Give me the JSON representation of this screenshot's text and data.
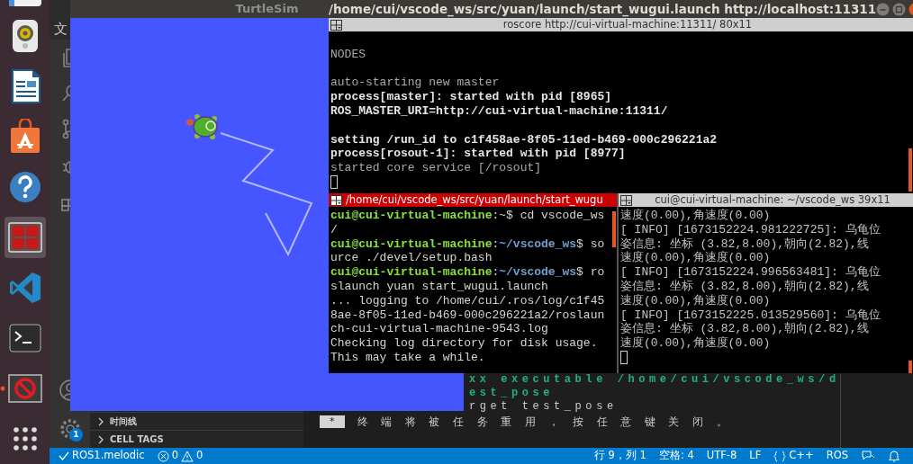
{
  "dock": {
    "items": [
      {
        "kind": "files",
        "selected": false,
        "running": false
      },
      {
        "kind": "speaker",
        "selected": false,
        "running": false
      },
      {
        "kind": "writer",
        "selected": false,
        "running": false
      },
      {
        "kind": "store",
        "selected": false,
        "running": false
      },
      {
        "kind": "help",
        "selected": false,
        "running": false
      },
      {
        "kind": "terminator",
        "selected": true,
        "running": false
      },
      {
        "kind": "vscode",
        "selected": false,
        "running": false
      },
      {
        "kind": "terminal",
        "selected": false,
        "running": false
      },
      {
        "kind": "blocked",
        "selected": false,
        "running": true
      },
      {
        "kind": "apps",
        "selected": false,
        "running": false
      }
    ]
  },
  "vscode": {
    "menu_fragment": "文",
    "settings_badge": "1",
    "sidebar_sections": [
      {
        "label": "时间线",
        "expanded": false
      },
      {
        "label": "CELL TAGS",
        "expanded": false
      }
    ],
    "terminal_lines": [
      {
        "kind": "cut_build",
        "text": "xx executable /home/cui/vscode_ws/d"
      },
      {
        "kind": "cut_build",
        "text": "est_pose"
      },
      {
        "kind": "cut_plain",
        "text": "rget test_pose"
      },
      {
        "kind": "notice",
        "badge": "*",
        "text": "终 端 将 被 任 务 重 用 ， 按 任 意 键 关 闭 。"
      }
    ],
    "status_bar": {
      "left": [
        {
          "kind": "sync",
          "text": "ROS1.melodic"
        },
        {
          "kind": "problems",
          "errors": "0",
          "warnings": "0"
        }
      ],
      "right": [
        {
          "kind": "text",
          "text": "行 9，列 1"
        },
        {
          "kind": "text",
          "text": "空格: 4"
        },
        {
          "kind": "text",
          "text": "UTF-8"
        },
        {
          "kind": "text",
          "text": "LF"
        },
        {
          "kind": "language",
          "text": "C++"
        },
        {
          "kind": "text",
          "text": "ROS"
        },
        {
          "kind": "feedback"
        },
        {
          "kind": "bell"
        }
      ]
    }
  },
  "turtlesim": {
    "title": "TurtleSim"
  },
  "terminator": {
    "title": "/home/cui/vscode_ws/src/yuan/launch/start_wugui.launch http://localhost:11311",
    "panes": [
      {
        "header": "roscore http://cui-virtual-machine:11311/ 80x11",
        "active": false,
        "cursor": true,
        "lines": [
          {
            "kind": "blank"
          },
          {
            "kind": "text",
            "segments": [
              {
                "kind": "plain",
                "text": "NODES"
              }
            ]
          },
          {
            "kind": "blank"
          },
          {
            "kind": "text",
            "segments": [
              {
                "kind": "plain",
                "text": "auto-starting new master"
              }
            ]
          },
          {
            "kind": "text",
            "segments": [
              {
                "kind": "bold",
                "text": "process[master]: started with pid [8965]"
              }
            ]
          },
          {
            "kind": "text",
            "segments": [
              {
                "kind": "bold",
                "text": "ROS_MASTER_URI=http://cui-virtual-machine:11311/"
              }
            ]
          },
          {
            "kind": "blank"
          },
          {
            "kind": "text",
            "segments": [
              {
                "kind": "bold",
                "text": "setting /run_id to c1f458ae-8f05-11ed-b469-000c296221a2"
              }
            ]
          },
          {
            "kind": "text",
            "segments": [
              {
                "kind": "bold",
                "text": "process[rosout-1]: started with pid [8977]"
              }
            ]
          },
          {
            "kind": "text",
            "segments": [
              {
                "kind": "plain",
                "text": "started core service [/rosout]"
              }
            ]
          }
        ]
      },
      {
        "header": "/home/cui/vscode_ws/src/yuan/launch/start_wugu",
        "active": true,
        "cursor": false,
        "lines": [
          {
            "kind": "text",
            "segments": [
              {
                "kind": "user",
                "text": "cui@cui-virtual-machine"
              },
              {
                "kind": "plain",
                "text": ":~$ cd vscode_ws"
              }
            ]
          },
          {
            "kind": "text",
            "segments": [
              {
                "kind": "plain",
                "text": "/"
              }
            ]
          },
          {
            "kind": "text",
            "segments": [
              {
                "kind": "user",
                "text": "cui@cui-virtual-machine"
              },
              {
                "kind": "plain",
                "text": ":"
              },
              {
                "kind": "path",
                "text": "~/vscode_ws"
              },
              {
                "kind": "plain",
                "text": "$ so"
              }
            ]
          },
          {
            "kind": "text",
            "segments": [
              {
                "kind": "plain",
                "text": "urce ./devel/setup.bash"
              }
            ]
          },
          {
            "kind": "text",
            "segments": [
              {
                "kind": "user",
                "text": "cui@cui-virtual-machine"
              },
              {
                "kind": "plain",
                "text": ":"
              },
              {
                "kind": "path",
                "text": "~/vscode_ws"
              },
              {
                "kind": "plain",
                "text": "$ ro"
              }
            ]
          },
          {
            "kind": "text",
            "segments": [
              {
                "kind": "plain",
                "text": "slaunch yuan start_wugui.launch"
              }
            ]
          },
          {
            "kind": "text",
            "segments": [
              {
                "kind": "plain",
                "text": "... logging to /home/cui/.ros/log/c1f45"
              }
            ]
          },
          {
            "kind": "text",
            "segments": [
              {
                "kind": "plain",
                "text": "8ae-8f05-11ed-b469-000c296221a2/roslaun"
              }
            ]
          },
          {
            "kind": "text",
            "segments": [
              {
                "kind": "plain",
                "text": "ch-cui-virtual-machine-9543.log"
              }
            ]
          },
          {
            "kind": "text",
            "segments": [
              {
                "kind": "plain",
                "text": "Checking log directory for disk usage."
              }
            ]
          },
          {
            "kind": "text",
            "segments": [
              {
                "kind": "plain",
                "text": "This may take a while."
              }
            ]
          }
        ]
      },
      {
        "header": "cui@cui-virtual-machine: ~/vscode_ws 39x11",
        "active": false,
        "cursor": true,
        "lines": [
          {
            "kind": "text",
            "segments": [
              {
                "kind": "plain",
                "text": "速度(0.00),角速度(0.00)"
              }
            ]
          },
          {
            "kind": "text",
            "segments": [
              {
                "kind": "plain",
                "text": "[ INFO] [1673152224.981222725]: 乌龟位"
              }
            ]
          },
          {
            "kind": "text",
            "segments": [
              {
                "kind": "plain",
                "text": "姿信息: 坐标 (3.82,8.00),朝向(2.82),线"
              }
            ]
          },
          {
            "kind": "text",
            "segments": [
              {
                "kind": "plain",
                "text": "速度(0.00),角速度(0.00)"
              }
            ]
          },
          {
            "kind": "text",
            "segments": [
              {
                "kind": "plain",
                "text": "[ INFO] [1673152224.996563481]: 乌龟位"
              }
            ]
          },
          {
            "kind": "text",
            "segments": [
              {
                "kind": "plain",
                "text": "姿信息: 坐标 (3.82,8.00),朝向(2.82),线"
              }
            ]
          },
          {
            "kind": "text",
            "segments": [
              {
                "kind": "plain",
                "text": "速度(0.00),角速度(0.00)"
              }
            ]
          },
          {
            "kind": "text",
            "segments": [
              {
                "kind": "plain",
                "text": "[ INFO] [1673152225.013529560]: 乌龟位"
              }
            ]
          },
          {
            "kind": "text",
            "segments": [
              {
                "kind": "plain",
                "text": "姿信息: 坐标 (3.82,8.00),朝向(2.82),线"
              }
            ]
          },
          {
            "kind": "text",
            "segments": [
              {
                "kind": "plain",
                "text": "速度(0.00),角速度(0.00)"
              }
            ]
          }
        ]
      }
    ]
  }
}
